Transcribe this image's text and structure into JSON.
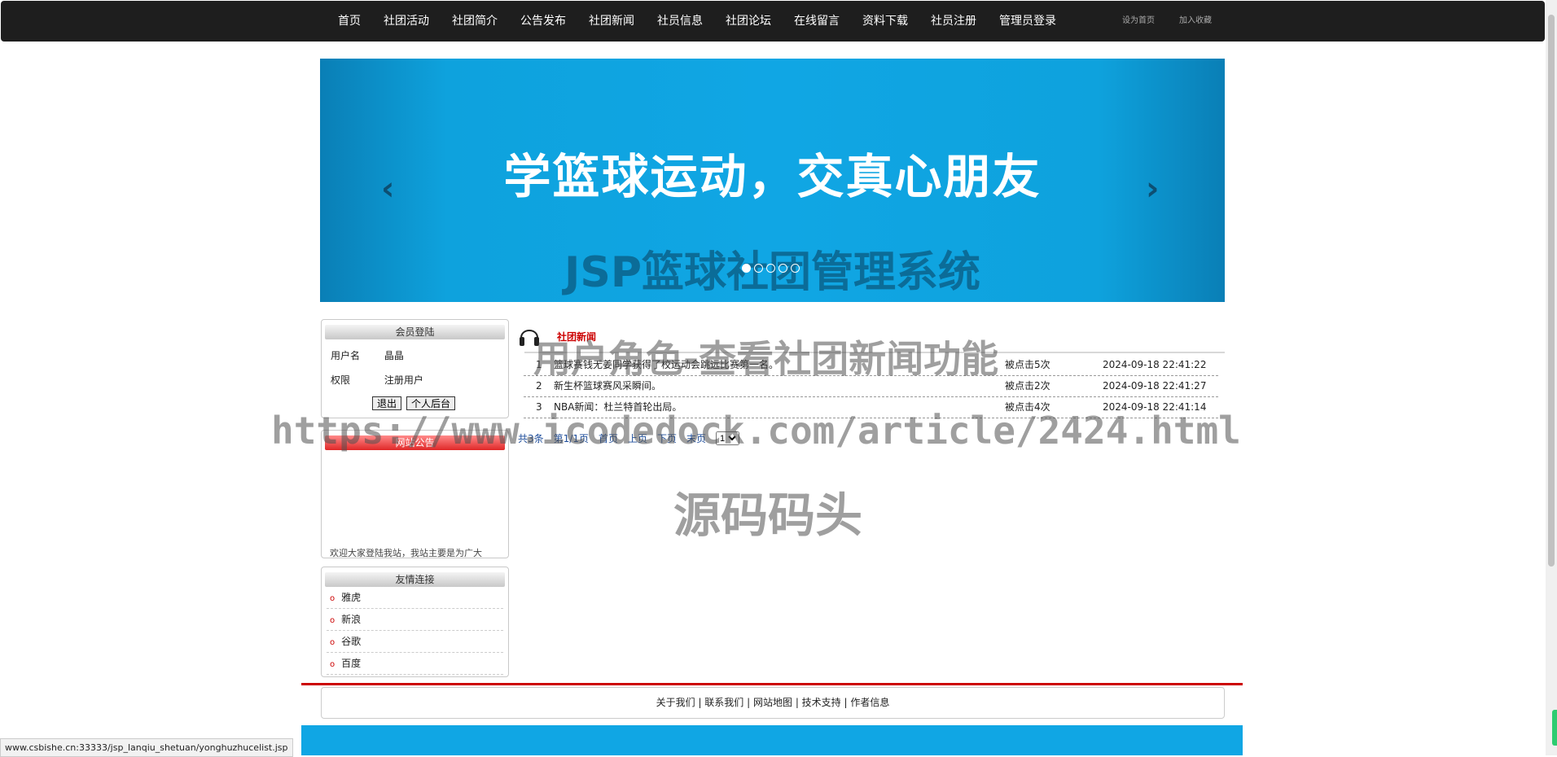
{
  "nav": {
    "items": [
      "首页",
      "社团活动",
      "社团简介",
      "公告发布",
      "社团新闻",
      "社员信息",
      "社团论坛",
      "在线留言",
      "资料下载",
      "社员注册",
      "管理员登录"
    ],
    "extras": [
      "设为首页",
      "加入收藏"
    ]
  },
  "banner": {
    "heading": "学篮球运动，交真心朋友",
    "subheading": "JSP篮球社团管理系统",
    "prev": "‹",
    "next": "›",
    "dots": 5,
    "active_dot": 0
  },
  "login_box": {
    "title": "会员登陆",
    "username_label": "用户名",
    "username_value": "晶晶",
    "role_label": "权限",
    "role_value": "注册用户",
    "logout_label": "退出",
    "backend_label": "个人后台"
  },
  "notice_box": {
    "title": "网站公告",
    "text": "欢迎大家登陆我站，我站主要是为广大"
  },
  "links_box": {
    "title": "友情连接",
    "items": [
      "雅虎",
      "新浪",
      "谷歌",
      "百度"
    ]
  },
  "news": {
    "title": "社团新闻",
    "rows": [
      {
        "no": "1",
        "title": "篮球赛钱无姜同学获得了校运动会跳远比赛第一名。",
        "clicks": "被点击5次",
        "time": "2024-09-18 22:41:22"
      },
      {
        "no": "2",
        "title": "新生杯篮球赛风采瞬间。",
        "clicks": "被点击2次",
        "time": "2024-09-18 22:41:27"
      },
      {
        "no": "3",
        "title": "NBA新闻：杜兰特首轮出局。",
        "clicks": "被点击4次",
        "time": "2024-09-18 22:41:14"
      }
    ],
    "pager": {
      "total": "共3条",
      "page": "第1/1页",
      "first": "首页",
      "prev": "上页",
      "next": "下页",
      "last": "末页",
      "select_value": "1"
    }
  },
  "watermarks": {
    "line1": "用户角色-查看社团新闻功能",
    "line2": "https://www.icodedock.com/article/2424.html",
    "line3": "源码码头"
  },
  "footer": {
    "links": [
      "关于我们",
      "联系我们",
      "网站地图",
      "技术支持",
      "作者信息"
    ],
    "separator": " | "
  },
  "status_url": "www.csbishe.cn:33333/jsp_lanqiu_shetuan/yonghuzhucelist.jsp"
}
